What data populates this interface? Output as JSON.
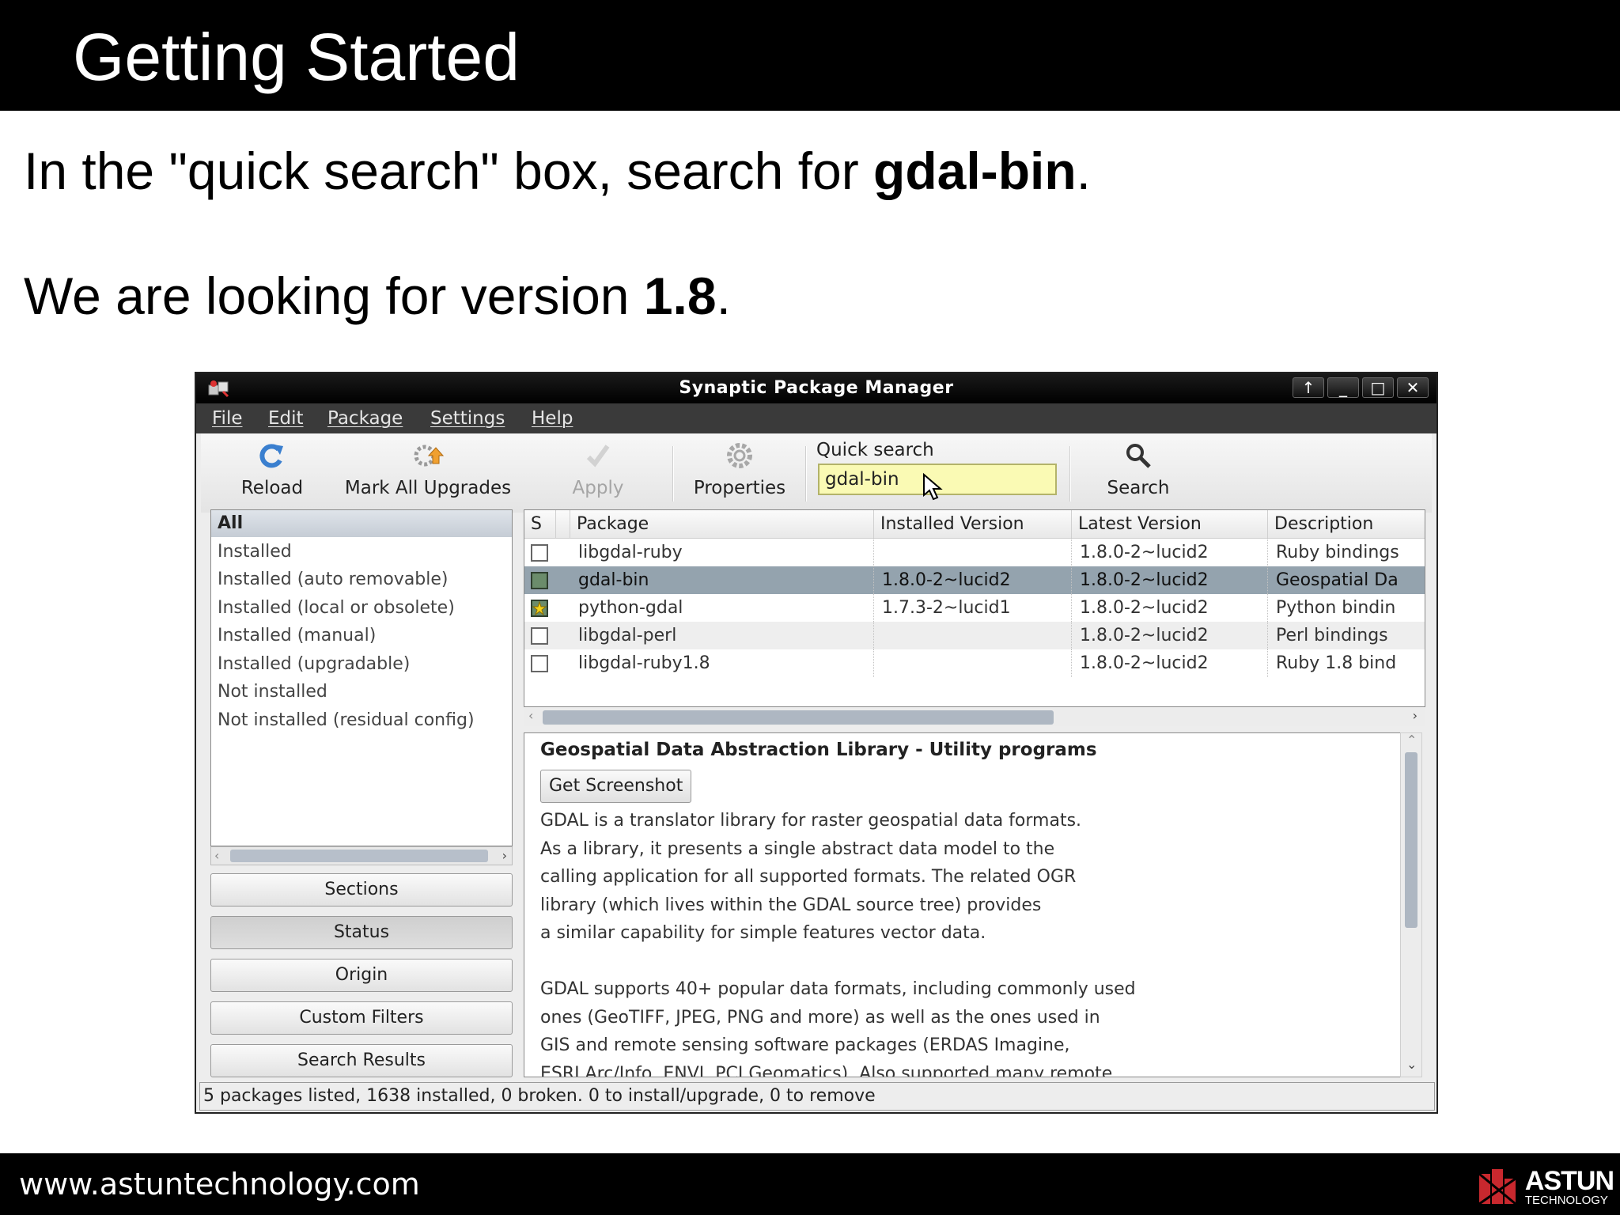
{
  "slide": {
    "title": "Getting Started",
    "line1_pre": "In the \"quick search\" box, search for ",
    "line1_bold": "gdal-bin",
    "line1_post": ".",
    "line2_pre": "We are looking for version ",
    "line2_bold": "1.8",
    "line2_post": ".",
    "footer_url": "www.astuntechnology.com",
    "logo_line1": "ASTUN",
    "logo_line2": "TECHNOLOGY"
  },
  "window": {
    "title": "Synaptic Package Manager",
    "buttons": [
      "↑",
      "_",
      "□",
      "✕"
    ]
  },
  "menu": [
    "File",
    "Edit",
    "Package",
    "Settings",
    "Help"
  ],
  "toolbar": {
    "reload": "Reload",
    "mark_all": "Mark All Upgrades",
    "apply": "Apply",
    "properties": "Properties",
    "search": "Search",
    "quick_search_label": "Quick search",
    "quick_search_value": "gdal-bin"
  },
  "filters": {
    "items": [
      "All",
      "Installed",
      "Installed (auto removable)",
      "Installed (local or obsolete)",
      "Installed (manual)",
      "Installed (upgradable)",
      "Not installed",
      "Not installed (residual config)"
    ],
    "selected": 0
  },
  "side_buttons": [
    "Sections",
    "Status",
    "Origin",
    "Custom Filters",
    "Search Results"
  ],
  "table": {
    "columns": [
      "S",
      "Package",
      "Installed Version",
      "Latest Version",
      "Description"
    ],
    "rows": [
      {
        "package": "libgdal-ruby",
        "installed": "",
        "latest": "1.8.0-2~lucid2",
        "description": "Ruby bindings"
      },
      {
        "package": "gdal-bin",
        "installed": "1.8.0-2~lucid2",
        "latest": "1.8.0-2~lucid2",
        "description": "Geospatial Da"
      },
      {
        "package": "python-gdal",
        "installed": "1.7.3-2~lucid1",
        "latest": "1.8.0-2~lucid2",
        "description": "Python bindin"
      },
      {
        "package": "libgdal-perl",
        "installed": "",
        "latest": "1.8.0-2~lucid2",
        "description": "Perl bindings"
      },
      {
        "package": "libgdal-ruby1.8",
        "installed": "",
        "latest": "1.8.0-2~lucid2",
        "description": "Ruby 1.8 bind"
      }
    ]
  },
  "details": {
    "title": "Geospatial Data Abstraction Library - Utility programs",
    "screenshot_button": "Get Screenshot",
    "lines": [
      "GDAL is a translator library for raster geospatial data formats.",
      "As a library, it presents a single abstract data model to the",
      "calling application for all supported formats. The related OGR",
      "library (which lives within the GDAL source tree) provides",
      "a similar capability for simple features vector data.",
      "",
      "GDAL supports 40+ popular data formats, including commonly used",
      "ones (GeoTIFF, JPEG, PNG and more) as well as the ones used in",
      "GIS and remote sensing software packages (ERDAS Imagine,",
      "ESRI Arc/Info, ENVI, PCI Geomatics). Also supported many remote"
    ]
  },
  "status": "5 packages listed, 1638 installed, 0 broken. 0 to install/upgrade, 0 to remove"
}
